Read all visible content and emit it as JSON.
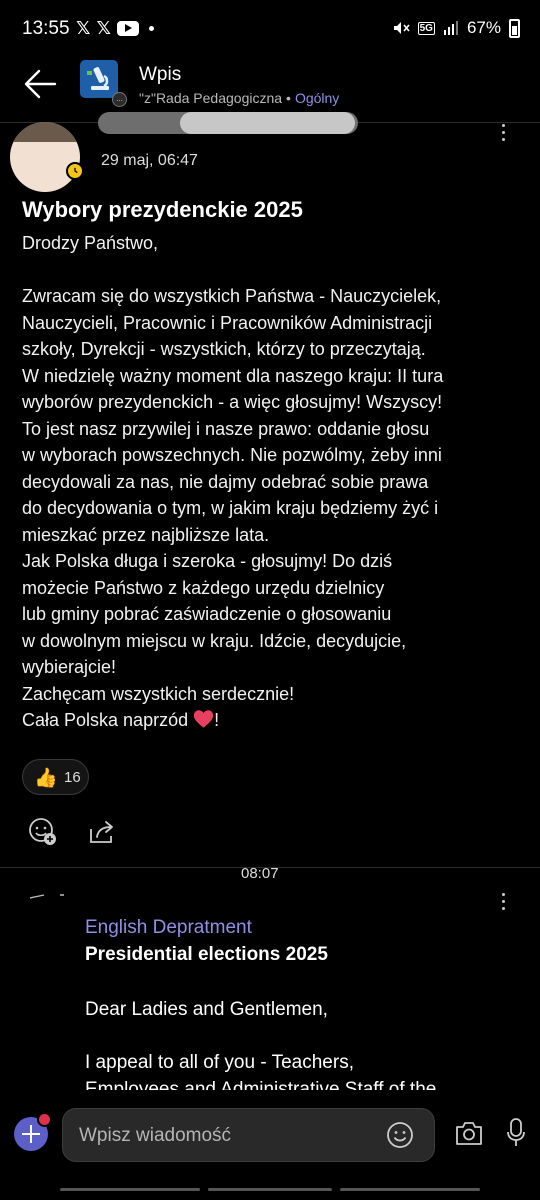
{
  "status_bar": {
    "time": "13:55",
    "left_icons": [
      "x-icon",
      "x-icon",
      "youtube-icon",
      "dot-icon"
    ],
    "network": "5G",
    "battery": "67%"
  },
  "header": {
    "title": "Wpis",
    "team": "\"z\"Rada Pedagogiczna",
    "separator": "•",
    "channel": "Ogólny",
    "logo_badge": "..."
  },
  "post": {
    "timestamp": "29 maj, 06:47",
    "title": "Wybory prezydenckie 2025",
    "greeting": "Drodzy Państwo,",
    "body_lines": [
      "Zwracam się do wszystkich Państwa - Nauczycielek,",
      "Nauczycieli, Pracownic i Pracowników Administracji",
      "szkoły, Dyrekcji - wszystkich, którzy to przeczytają.",
      "W niedzielę ważny moment dla naszego kraju: II tura",
      "wyborów prezydenckich - a więc głosujmy! Wszyscy!",
      "To jest nasz przywilej i nasze prawo: oddanie głosu",
      "w wyborach powszechnych. Nie pozwólmy, żeby inni",
      "decydowali za nas, nie dajmy odebrać sobie prawa",
      "do decydowania o tym, w jakim kraju będziemy żyć i",
      "mieszkać przez najbliższe lata.",
      "Jak Polska długa i szeroka - głosujmy! Do dziś",
      "możecie Państwo z każdego urzędu dzielnicy",
      "lub gminy pobrać zaświadczenie o głosowaniu",
      "w dowolnym miejscu w kraju. Idźcie, decydujcie,",
      "wybierajcie!",
      "Zachęcam wszystkich serdecznie!"
    ],
    "closing": "Cała Polska naprzód",
    "closing_end": "!",
    "reaction_emoji": "👍",
    "reaction_count": "16",
    "heart_color": "#e8415f"
  },
  "reply": {
    "timestamp": "08:07",
    "author": "English Depratment",
    "title": "Presidential elections 2025",
    "greeting": "Dear Ladies and Gentlemen,",
    "body_lines": [
      "I appeal to all of you - Teachers,",
      "Employees and Administrative Staff of the"
    ]
  },
  "composer": {
    "placeholder": "Wpisz wiadomość"
  },
  "colors": {
    "accent": "#8f90e6",
    "plus_button": "#5b5fc7",
    "notification": "#e0314a",
    "presence_away": "#f5c518"
  }
}
